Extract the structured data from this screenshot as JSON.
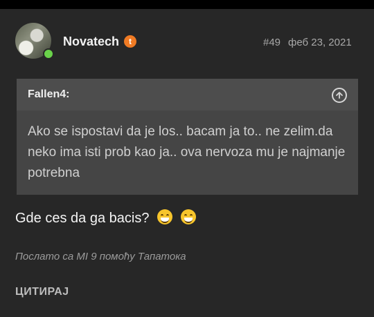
{
  "post": {
    "username": "Novatech",
    "badge": "t",
    "post_number": "#49",
    "date": "феб 23, 2021",
    "quote": {
      "author": "Fallen4:",
      "text": "Ako se ispostavi da je los.. bacam ja to.. ne zelim.da neko ima isti prob kao ja.. ova nervoza mu je najmanje potrebna"
    },
    "reply_text": "Gde ces da ga bacis?",
    "emojis": [
      "grinning-emoji",
      "grinning-emoji"
    ],
    "signature": "Послато са MI 9 помоћу Тапатока",
    "quote_button": "ЦИТИРАЈ"
  },
  "colors": {
    "background": "#272727",
    "quote_box": "#454545",
    "badge": "#f07b24",
    "online": "#6ad24a"
  }
}
